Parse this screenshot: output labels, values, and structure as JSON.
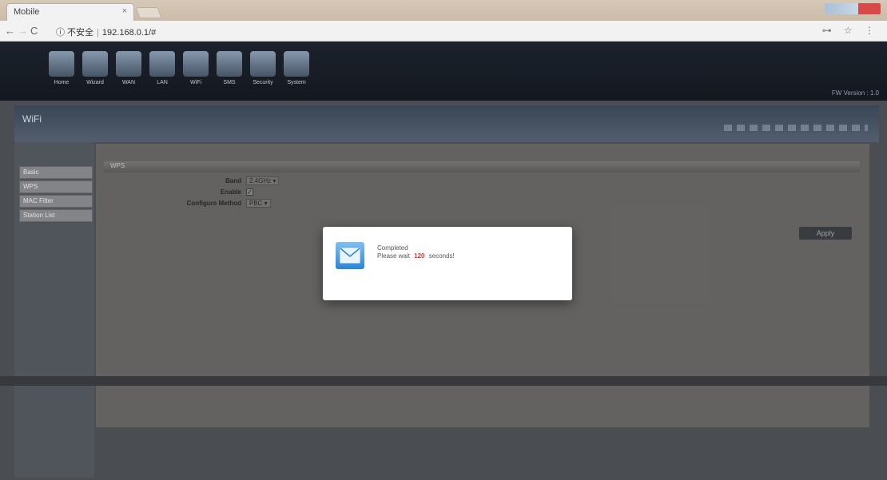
{
  "browser": {
    "tab_title": "Mobile",
    "tab_close": "×",
    "url_security": "ⓘ 不安全",
    "url": "192.168.0.1/#",
    "toolbar_right": "⊶ ☆ ⋮"
  },
  "router": {
    "nav": [
      {
        "label": "Home",
        "icon": "home-icon"
      },
      {
        "label": "Wizard",
        "icon": "wizard-icon"
      },
      {
        "label": "WAN",
        "icon": "wan-icon"
      },
      {
        "label": "LAN",
        "icon": "lan-icon"
      },
      {
        "label": "WiFi",
        "icon": "wifi-icon"
      },
      {
        "label": "SMS",
        "icon": "sms-icon"
      },
      {
        "label": "Security",
        "icon": "security-icon"
      },
      {
        "label": "System",
        "icon": "system-icon"
      }
    ],
    "fw_version": "FW Version : 1.0"
  },
  "page": {
    "title": "WiFi",
    "sidebar": [
      "Basic",
      "WPS",
      "MAC Filter",
      "Station List"
    ],
    "section_title": "WPS",
    "fields": {
      "band_label": "Band",
      "band_value": "2.4GHz ▾",
      "enable_label": "Enable",
      "enable_value": "✓",
      "method_label": "Configure Method",
      "method_value": "PBC ▾"
    },
    "apply_label": "Apply"
  },
  "dialog": {
    "title": "Completed",
    "message_prefix": "Please wait",
    "countdown": "120",
    "message_suffix": "seconds!"
  },
  "colors": {
    "header_bg": "#1e2430",
    "countdown": "#e53030",
    "dialog_bg": "#ffffff"
  }
}
